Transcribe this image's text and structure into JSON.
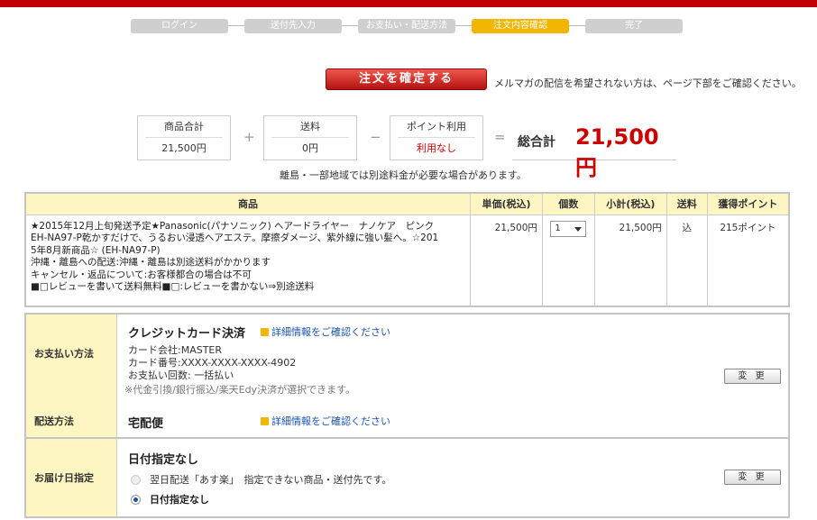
{
  "steps": [
    "ログイン",
    "送付先入力",
    "お支払い・配送方法",
    "注文内容確認",
    "完了"
  ],
  "active_step": 3,
  "confirm_button": "注文を確定する",
  "mail_note": "メルマガの配信を希望されない方は、ページ下部をご確認ください。",
  "totals": {
    "subtotal_label": "商品合計",
    "subtotal_value": "21,500円",
    "shipping_label": "送料",
    "shipping_value": "0円",
    "points_label": "ポイント利用",
    "points_value": "利用なし",
    "plus": "+",
    "minus": "−",
    "equals": "=",
    "grand_label": "総合計",
    "grand_value": "21,500円"
  },
  "remote_note": "離島・一部地域では別途料金が必要な場合があります。",
  "table": {
    "headers": [
      "商品",
      "単価(税込)",
      "個数",
      "小計(税込)",
      "送料",
      "獲得ポイント"
    ],
    "row": {
      "name_lines": [
        "★2015年12月上旬発送予定★Panasonic(パナソニック) ヘアードライヤー　ナノケア　ピンク",
        "EH-NA97-P乾かすだけで、うるおい浸透ヘアエステ。摩擦ダメージ、紫外線に強い髪へ。☆201",
        "5年8月新商品☆ (EH-NA97-P)",
        "沖縄・離島への配送:沖縄・離島は別途送料がかかります",
        "キャンセル・返品について:お客様都合の場合は不可",
        "■□レビューを書いて送料無料■□:レビューを書かない⇒別途送料"
      ],
      "unit_price": "21,500円",
      "quantity": "1",
      "subtotal": "21,500円",
      "shipping": "込",
      "points": "215ポイント"
    }
  },
  "payment": {
    "side_label": "お支払い方法",
    "method": "クレジットカード決済",
    "detail_link": "詳細情報をご確認ください",
    "card_company": "カード会社:MASTER",
    "card_number": "カード番号:XXXX-XXXX-XXXX-4902",
    "installments": "お支払い回数: 一括払い",
    "note": "※代金引換/銀行振込/楽天Edy決済が選択できます。",
    "change_button": "変 更"
  },
  "delivery": {
    "side_label": "配送方法",
    "method": "宅配便",
    "detail_link": "詳細情報をご確認ください"
  },
  "delivery_date": {
    "side_label": "お届け日指定",
    "title": "日付指定なし",
    "option1": "翌日配送「あす楽」　指定できない商品・送付先です。",
    "option2": "日付指定なし",
    "change_button": "変 更"
  }
}
